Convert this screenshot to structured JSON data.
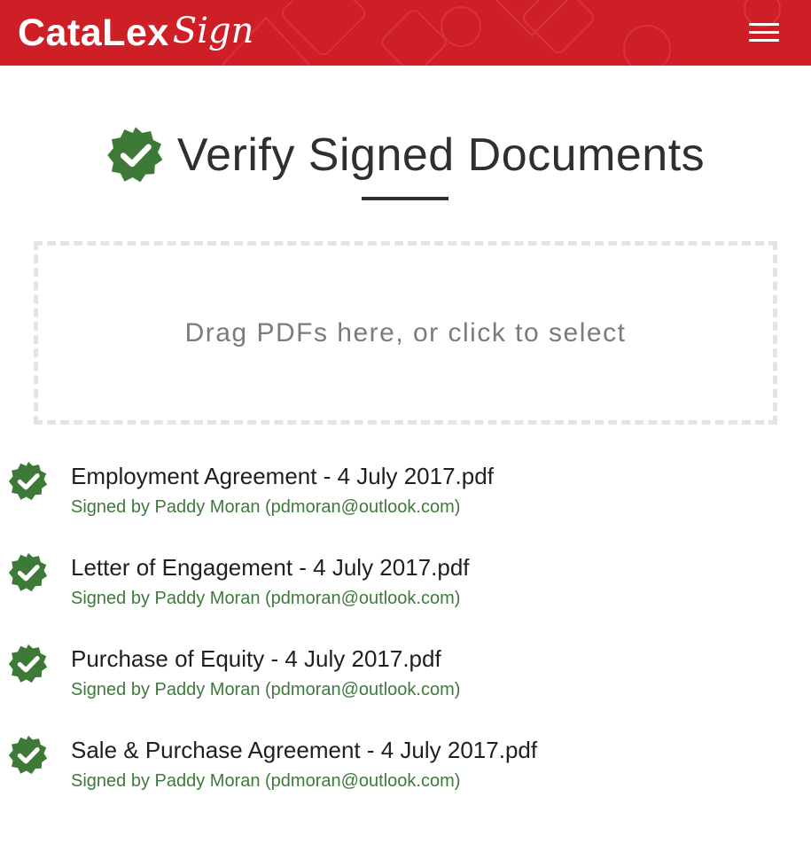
{
  "header": {
    "logo_main": "CataLex",
    "logo_sub": "Sign",
    "menu_icon": "hamburger-menu-icon",
    "background_color": "#cf1f26"
  },
  "main": {
    "title": "Verify Signed Documents",
    "title_icon": "verified-badge-icon",
    "dropzone_text": "Drag PDFs here, or click to select"
  },
  "documents": [
    {
      "name": "Employment Agreement - 4 July 2017.pdf",
      "signer": "Signed by Paddy Moran (pdmoran@outlook.com)",
      "icon": "verified-badge-icon"
    },
    {
      "name": "Letter of Engagement - 4 July 2017.pdf",
      "signer": "Signed by Paddy Moran (pdmoran@outlook.com)",
      "icon": "verified-badge-icon"
    },
    {
      "name": "Purchase of Equity - 4 July 2017.pdf",
      "signer": "Signed by Paddy Moran (pdmoran@outlook.com)",
      "icon": "verified-badge-icon"
    },
    {
      "name": "Sale & Purchase Agreement - 4 July 2017.pdf",
      "signer": "Signed by Paddy Moran (pdmoran@outlook.com)",
      "icon": "verified-badge-icon"
    }
  ],
  "colors": {
    "brand_red": "#cf1f26",
    "verified_green": "#3d7a37",
    "signer_text_green": "#3e7a3a"
  }
}
